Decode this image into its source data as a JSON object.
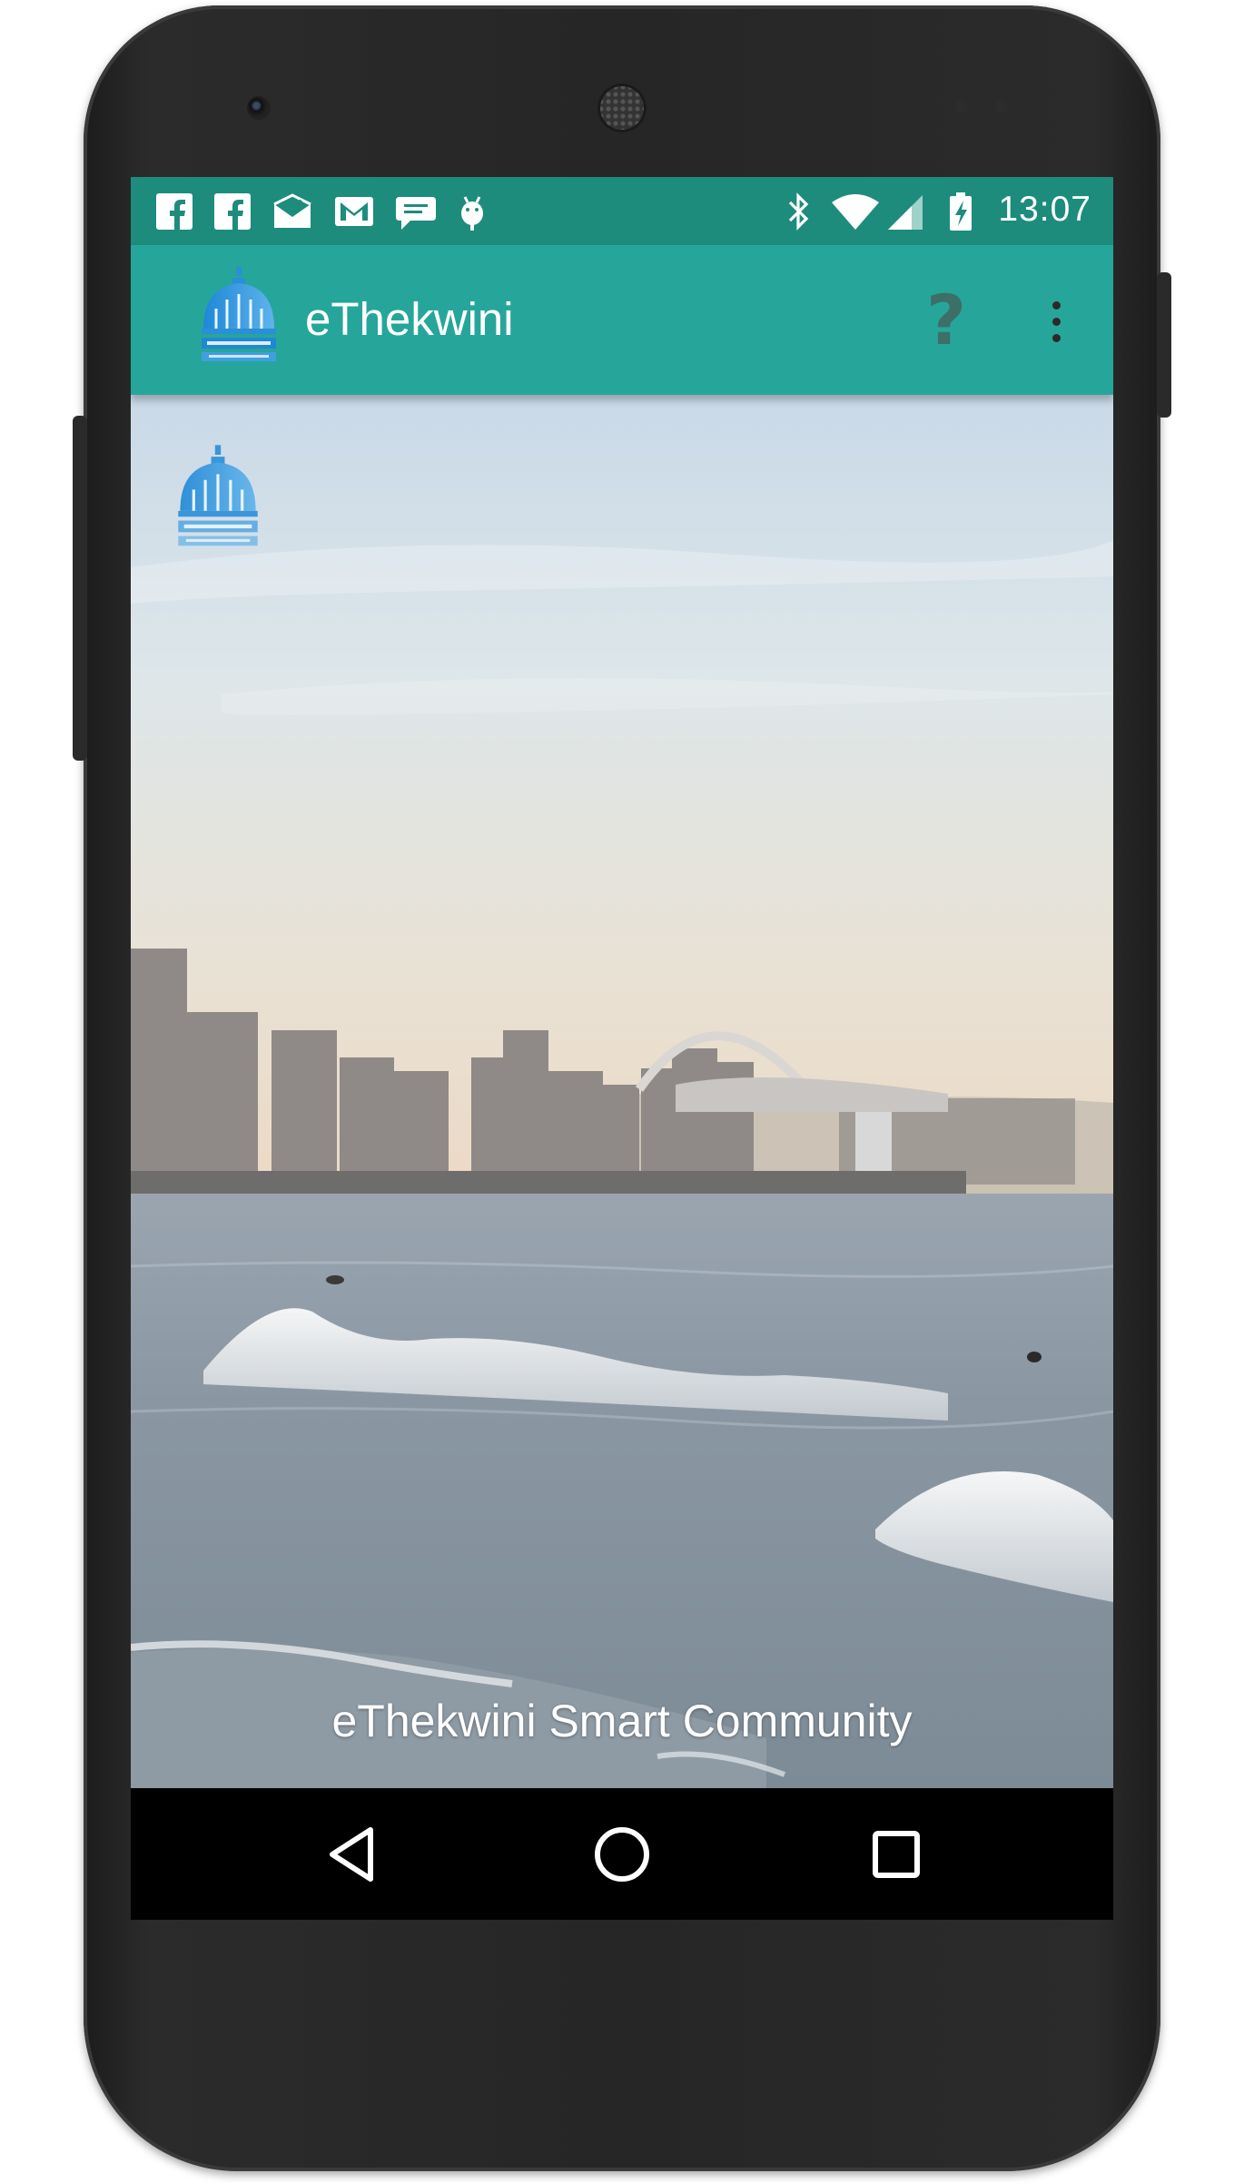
{
  "status_bar": {
    "time": "13:07",
    "notification_icons": [
      "facebook-icon",
      "facebook-icon",
      "mail-check-icon",
      "gmail-icon",
      "chat-bubble-icon",
      "android-debug-icon"
    ],
    "system_icons": [
      "bluetooth-icon",
      "wifi-icon",
      "cell-signal-icon",
      "battery-charging-icon"
    ]
  },
  "app_bar": {
    "title": "eThekwini",
    "logo_icon": "ethekwini-municipality-logo",
    "help_label": "?",
    "overflow_icon": "more-vert-icon",
    "background_color": "#26a69a"
  },
  "content": {
    "tagline": "eThekwini Smart Community",
    "background_image": "durban-beachfront-skyline"
  },
  "nav_bar": {
    "buttons": [
      "back-icon",
      "home-icon",
      "recents-icon"
    ]
  }
}
